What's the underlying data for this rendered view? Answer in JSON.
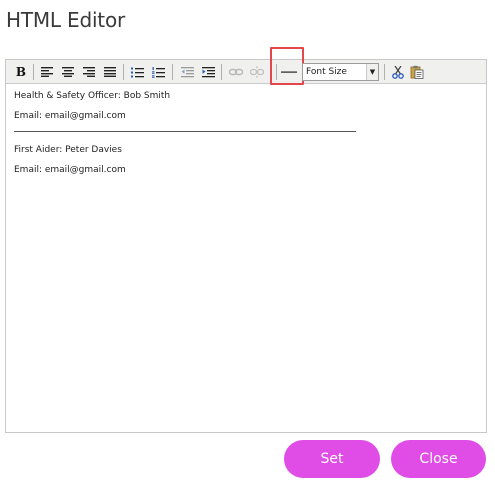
{
  "dialog": {
    "title": "HTML Editor"
  },
  "toolbar": {
    "bold_label": "B",
    "font_size_label": "Font Size",
    "tools": [
      "bold-icon",
      "align-left-icon",
      "align-center-icon",
      "align-right-icon",
      "align-justify-icon",
      "bullet-list-icon",
      "numbered-list-icon",
      "outdent-icon",
      "indent-icon",
      "link-icon",
      "unlink-icon",
      "horizontal-rule-icon",
      "cut-icon",
      "paste-icon"
    ],
    "highlight_color": "#e4474b"
  },
  "content": {
    "line1": "Health & Safety Officer: Bob Smith",
    "line2": "Email: email@gmail.com",
    "line3": "First Aider: Peter Davies",
    "line4": "Email: email@gmail.com"
  },
  "buttons": {
    "set_label": "Set",
    "close_label": "Close",
    "color": "#e04ce6"
  }
}
